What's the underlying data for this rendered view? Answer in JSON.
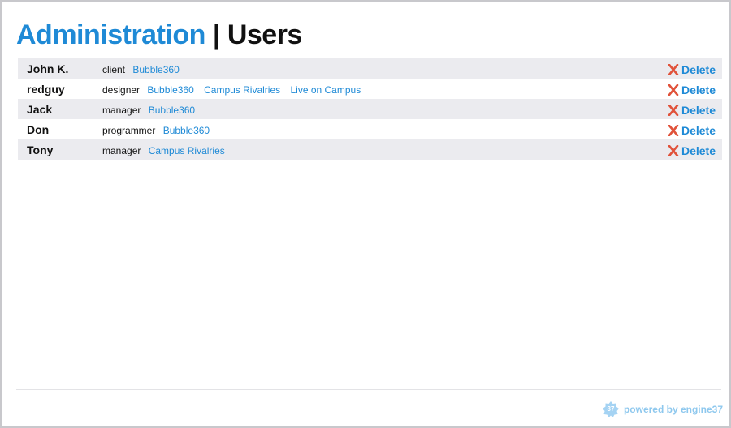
{
  "header": {
    "section": "Administration",
    "separator": "|",
    "page": "Users"
  },
  "delete_label": "Delete",
  "users": [
    {
      "name": "John K.",
      "role": "client",
      "projects": [
        "Bubble360"
      ]
    },
    {
      "name": "redguy",
      "role": "designer",
      "projects": [
        "Bubble360",
        "Campus Rivalries",
        "Live on Campus"
      ]
    },
    {
      "name": "Jack",
      "role": "manager",
      "projects": [
        "Bubble360"
      ]
    },
    {
      "name": "Don",
      "role": "programmer",
      "projects": [
        "Bubble360"
      ]
    },
    {
      "name": "Tony",
      "role": "manager",
      "projects": [
        "Campus Rivalries"
      ]
    }
  ],
  "footer": {
    "powered": "powered by engine37",
    "badge": "37"
  },
  "colors": {
    "link": "#1f8ad6",
    "row_alt": "#ebebef",
    "delete_icon": "#e0523a",
    "footer_text": "#8ec8ee"
  },
  "icons": {
    "delete": "x-icon",
    "footer": "engine37-badge-icon"
  }
}
